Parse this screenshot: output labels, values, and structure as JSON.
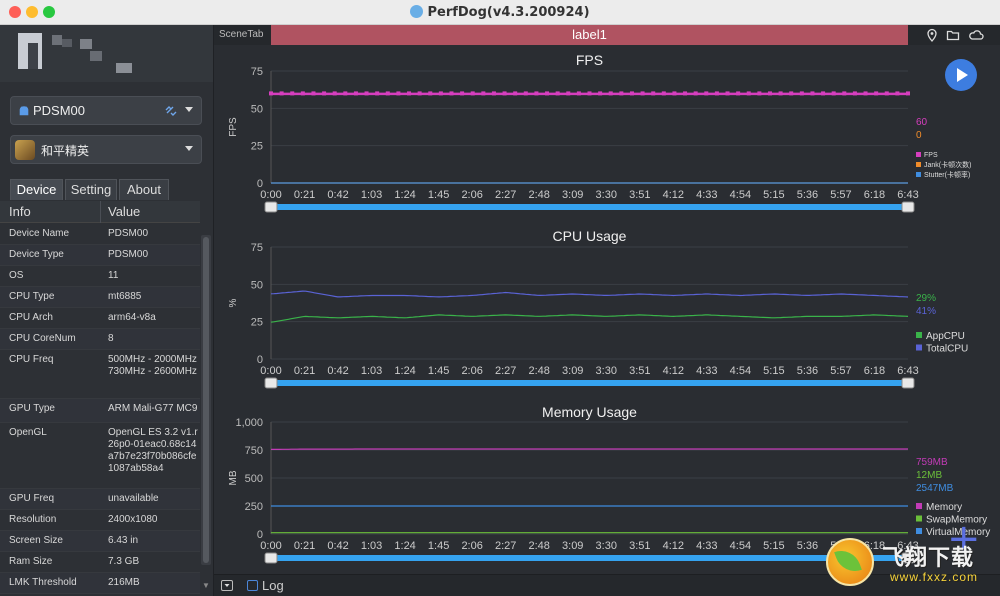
{
  "window": {
    "title": "PerfDog(v4.3.200924)",
    "traffic_lights": [
      "#fe5f57",
      "#febc2e",
      "#28c840"
    ]
  },
  "sidebar": {
    "device_select": {
      "value": "PDSM00",
      "icon": "android-icon"
    },
    "app_select": {
      "value": "和平精英",
      "icon": "game-icon"
    },
    "tabs": [
      {
        "label": "Device",
        "active": true
      },
      {
        "label": "Setting",
        "active": false
      },
      {
        "label": "About",
        "active": false
      }
    ],
    "table": {
      "headers": [
        "Info",
        "Value"
      ],
      "rows": [
        {
          "key": "Device Name",
          "value": "PDSM00"
        },
        {
          "key": "Device Type",
          "value": "PDSM00"
        },
        {
          "key": "OS",
          "value": "11"
        },
        {
          "key": "CPU Type",
          "value": "mt6885"
        },
        {
          "key": "CPU Arch",
          "value": "arm64-v8a"
        },
        {
          "key": "CPU CoreNum",
          "value": "8"
        },
        {
          "key": "CPU Freq",
          "value": "500MHz - 2000MHz 730MHz - 2600MHz"
        },
        {
          "key": "GPU Type",
          "value": "ARM Mali-G77 MC9"
        },
        {
          "key": "OpenGL",
          "value": "OpenGL ES 3.2 v1.r26p0-01eac0.68c14a7b7e23f70b086cfe1087ab58a4"
        },
        {
          "key": "GPU Freq",
          "value": "unavailable"
        },
        {
          "key": "Resolution",
          "value": "2400x1080"
        },
        {
          "key": "Screen Size",
          "value": "6.43 in"
        },
        {
          "key": "Ram Size",
          "value": "7.3 GB"
        },
        {
          "key": "LMK Threshold",
          "value": "216MB"
        }
      ]
    }
  },
  "main": {
    "scene_tab_label": "SceneTab",
    "active_scene": "label1",
    "log_label": "Log",
    "icons": [
      "location-icon",
      "folder-icon",
      "cloud-icon",
      "play-icon",
      "add-icon"
    ]
  },
  "chart_data": [
    {
      "type": "line",
      "title": "FPS",
      "ylabel": "FPS",
      "ylim": [
        0,
        75
      ],
      "yticks": [
        "75",
        "50",
        "25",
        "0"
      ],
      "xticks": [
        "0:00",
        "0:21",
        "0:42",
        "1:03",
        "1:24",
        "1:45",
        "2:06",
        "2:27",
        "2:48",
        "3:09",
        "3:30",
        "3:51",
        "4:12",
        "4:33",
        "4:54",
        "5:15",
        "5:36",
        "5:57",
        "6:18",
        "6:43"
      ],
      "series": [
        {
          "name": "FPS",
          "color": "#d63ebe",
          "current": "60",
          "values": [
            60,
            60,
            60,
            60,
            60,
            60,
            60,
            60,
            60,
            60,
            60,
            60,
            60,
            60,
            60,
            60,
            60,
            60,
            60,
            60
          ]
        },
        {
          "name": "Jank(卡顿次数)",
          "color": "#f08c2a",
          "current": "0",
          "values": [
            0,
            0,
            0,
            0,
            0,
            0,
            0,
            0,
            0,
            0,
            0,
            0,
            0,
            0,
            0,
            0,
            0,
            0,
            0,
            0
          ]
        },
        {
          "name": "Stutter(卡顿率)",
          "color": "#3f8de0",
          "current": "",
          "values": [
            0,
            0,
            0,
            0,
            0,
            0,
            0,
            0,
            0,
            0,
            0,
            0,
            0,
            0,
            0,
            0,
            0,
            0,
            0,
            0
          ]
        }
      ]
    },
    {
      "type": "line",
      "title": "CPU Usage",
      "ylabel": "%",
      "ylim": [
        0,
        75
      ],
      "yticks": [
        "75",
        "50",
        "25",
        "0"
      ],
      "xticks": [
        "0:00",
        "0:21",
        "0:42",
        "1:03",
        "1:24",
        "1:45",
        "2:06",
        "2:27",
        "2:48",
        "3:09",
        "3:30",
        "3:51",
        "4:12",
        "4:33",
        "4:54",
        "5:15",
        "5:36",
        "5:57",
        "6:18",
        "6:43"
      ],
      "series": [
        {
          "name": "AppCPU",
          "color": "#3ab34a",
          "current": "29%",
          "values": [
            26,
            30,
            29,
            30,
            29,
            31,
            30,
            31,
            30,
            31,
            30,
            31,
            30,
            31,
            30,
            29,
            30,
            30,
            31,
            30
          ]
        },
        {
          "name": "TotalCPU",
          "color": "#5a63d6",
          "current": "41%",
          "values": [
            45,
            47,
            43,
            44,
            44,
            43,
            44,
            46,
            44,
            45,
            44,
            45,
            44,
            45,
            44,
            45,
            44,
            45,
            44,
            43
          ]
        }
      ]
    },
    {
      "type": "line",
      "title": "Memory Usage",
      "ylabel": "MB",
      "ylim": [
        0,
        1000
      ],
      "yticks": [
        "1,000",
        "750",
        "500",
        "250",
        "0"
      ],
      "xticks": [
        "0:00",
        "0:21",
        "0:42",
        "1:03",
        "1:24",
        "1:45",
        "2:06",
        "2:27",
        "2:48",
        "3:09",
        "3:30",
        "3:51",
        "4:12",
        "4:33",
        "4:54",
        "5:15",
        "5:36",
        "5:57",
        "6:18",
        "6:43"
      ],
      "series": [
        {
          "name": "Memory",
          "color": "#c23bb6",
          "current": "759MB",
          "values": [
            755,
            758,
            758,
            759,
            759,
            759,
            759,
            759,
            759,
            759,
            759,
            759,
            759,
            759,
            759,
            759,
            759,
            759,
            759,
            759
          ]
        },
        {
          "name": "SwapMemory",
          "color": "#6bbf3a",
          "current": "12MB",
          "values": [
            12,
            12,
            12,
            12,
            12,
            12,
            12,
            12,
            12,
            12,
            12,
            12,
            12,
            12,
            12,
            12,
            12,
            12,
            12,
            12
          ]
        },
        {
          "name": "VirtualMemory",
          "color": "#3f8de0",
          "current": "2547MB",
          "values": [
            250,
            250,
            250,
            250,
            250,
            250,
            250,
            250,
            250,
            250,
            250,
            250,
            250,
            250,
            250,
            250,
            250,
            250,
            250,
            250
          ]
        }
      ]
    }
  ],
  "watermark": {
    "text": "飞翔下载",
    "url": "www.fxxz.com"
  }
}
